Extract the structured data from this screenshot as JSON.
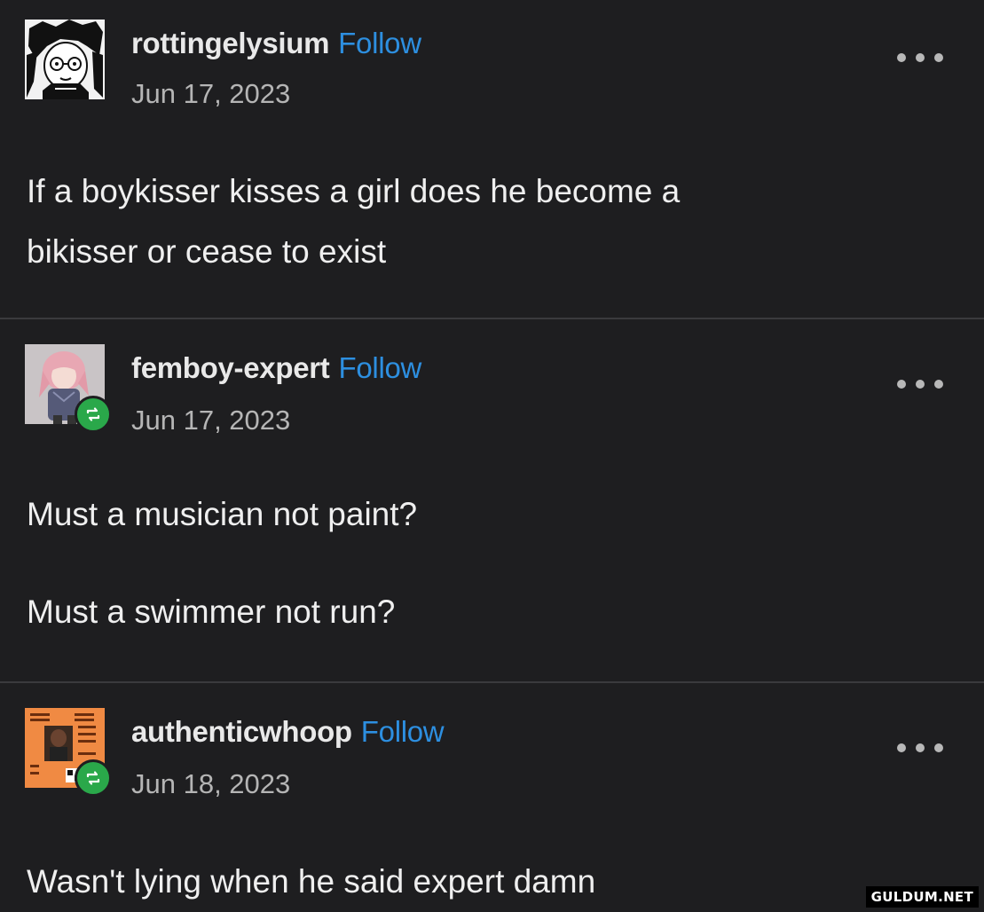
{
  "posts": [
    {
      "username": "rottingelysium",
      "follow_label": "Follow",
      "date": "Jun 17, 2023",
      "body": [
        "If a boykisser kisses a girl does he become a",
        "bikisser or cease to exist"
      ],
      "avatar_icon": "manga-character-avatar-icon",
      "reblogged": false
    },
    {
      "username": "femboy-expert",
      "follow_label": "Follow",
      "date": "Jun 17, 2023",
      "body": [
        "Must a musician not paint?",
        "Must a swimmer not run?"
      ],
      "avatar_icon": "pink-hair-character-avatar-icon",
      "reblogged": true
    },
    {
      "username": "authenticwhoop",
      "follow_label": "Follow",
      "date": "Jun 18, 2023",
      "body": [
        "Wasn't lying when he said expert damn"
      ],
      "avatar_icon": "album-cover-avatar-icon",
      "reblogged": true
    }
  ],
  "watermark": "GULDUM.NET",
  "colors": {
    "background": "#1e1e20",
    "follow": "#2d8fe0",
    "reblog_badge": "#2aa84a",
    "divider": "#3a3a3d"
  }
}
